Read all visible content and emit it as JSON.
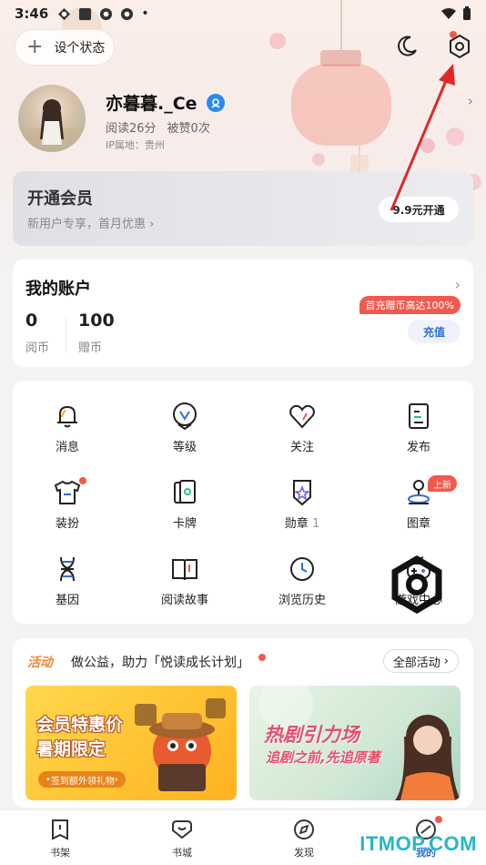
{
  "status_bar": {
    "time": "3:46"
  },
  "header": {
    "state_button": "设个状态"
  },
  "profile": {
    "name": "亦暮暮._Ce",
    "read_time": "阅读26分",
    "likes": "被赞0次",
    "ip_location": "IP属地：贵州"
  },
  "vip": {
    "title": "开通会员",
    "subtitle": "新用户专享，首月优惠",
    "button": "9.9元开通"
  },
  "account": {
    "title": "我的账户",
    "coins_value": "0",
    "coins_label": "阅币",
    "gift_value": "100",
    "gift_label": "赠币",
    "promo": "首充赠币高达100%",
    "recharge": "充值"
  },
  "grid": {
    "items": [
      {
        "label": "消息",
        "icon": "bell-icon"
      },
      {
        "label": "等级",
        "icon": "level-icon"
      },
      {
        "label": "关注",
        "icon": "heart-icon"
      },
      {
        "label": "发布",
        "icon": "publish-icon"
      },
      {
        "label": "装扮",
        "icon": "shirt-icon"
      },
      {
        "label": "卡牌",
        "icon": "cards-icon"
      },
      {
        "label": "勋章",
        "icon": "medal-icon",
        "count": "1"
      },
      {
        "label": "图章",
        "icon": "stamp-icon",
        "tag": "上新"
      },
      {
        "label": "基因",
        "icon": "dna-icon"
      },
      {
        "label": "阅读故事",
        "icon": "book-icon"
      },
      {
        "label": "浏览历史",
        "icon": "history-icon"
      },
      {
        "label": "游戏中心",
        "icon": "game-icon"
      }
    ]
  },
  "activity": {
    "tag": "活动",
    "text": "做公益，助力「悦读成长计划」",
    "all_button": "全部活动",
    "banner1": {
      "line1": "会员特惠价",
      "line2": "暑期限定",
      "sub": "签到额外领礼物"
    },
    "banner2": {
      "line1": "热剧引力场",
      "line2": "追剧之前,先追原著"
    }
  },
  "tabbar": {
    "tabs": [
      {
        "label": "书架",
        "icon": "bookshelf-icon"
      },
      {
        "label": "书城",
        "icon": "bookstore-icon"
      },
      {
        "label": "发现",
        "icon": "discover-icon"
      },
      {
        "label": "我的",
        "icon": "me-icon"
      }
    ]
  },
  "watermark": "ITMOP.COM",
  "colors": {
    "accent_blue": "#2a6fd6",
    "promo_red": "#f05a4e",
    "activity_orange": "#f5862f",
    "annotation_red": "#e02828"
  }
}
